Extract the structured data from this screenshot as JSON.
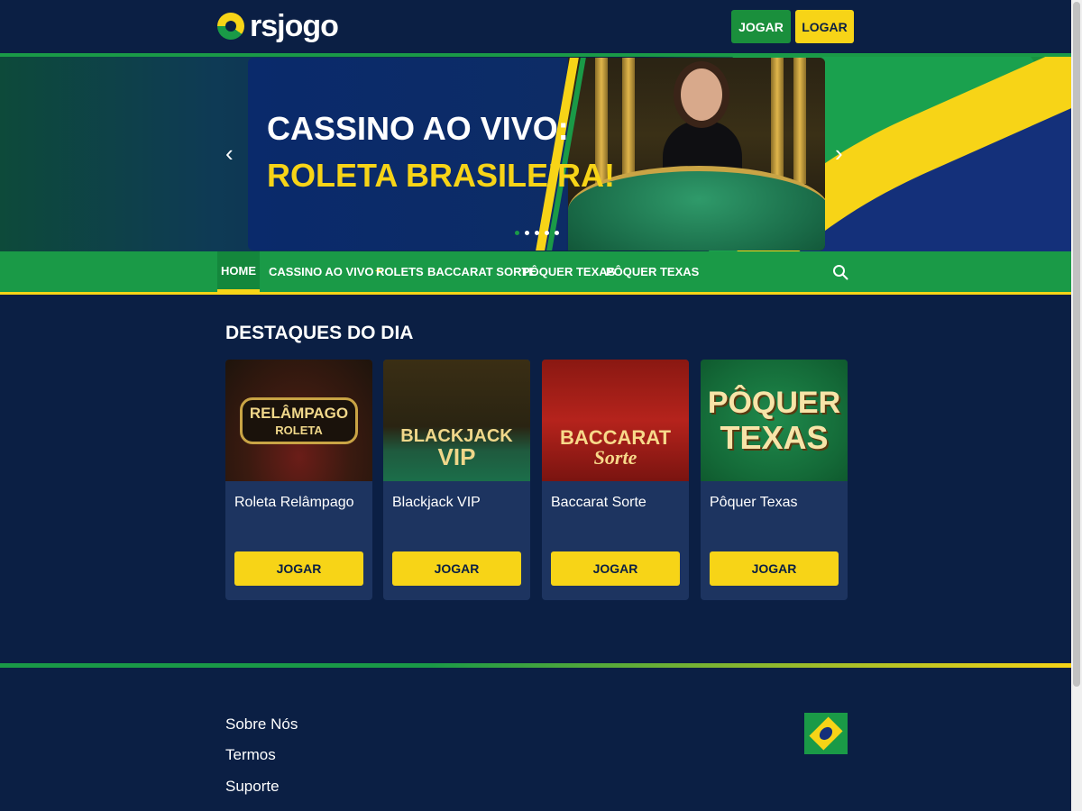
{
  "header": {
    "logo_text": "rsjogo",
    "jogar_label": "JOGAR",
    "logar_label": "LOGAR"
  },
  "hero": {
    "title_line1": "CASSINO AO VIVO:",
    "title_line2": "ROLETA BRASILEIRA!",
    "prev_icon": "‹",
    "next_icon": "›",
    "slide_count": 5,
    "active_slide": 1
  },
  "nav": {
    "items": [
      {
        "label": "HOME"
      },
      {
        "label": "CASSINO AO VIVO"
      },
      {
        "label": "ROLETS"
      },
      {
        "label": "BACCARAT SORTE"
      },
      {
        "label": "PÔQUER TEXAS"
      },
      {
        "label": "PÔQUER TEXAS"
      }
    ],
    "search_icon": "search-icon"
  },
  "featured": {
    "title": "DESTAQUES DO DIA",
    "cards": [
      {
        "name": "Roleta Relâmpago",
        "thumb_line1": "RELÂMPAGO",
        "thumb_line2": "ROLETA",
        "button": "JOGAR"
      },
      {
        "name": "Blackjack VIP",
        "thumb_line1": "BLACKJACK",
        "thumb_line2": "VIP",
        "button": "JOGAR"
      },
      {
        "name": "Baccarat Sorte",
        "thumb_line1": "BACCARAT",
        "thumb_line2": "Sorte",
        "button": "JOGAR"
      },
      {
        "name": "Pôquer Texas",
        "thumb_line1": "PÔQUER",
        "thumb_line2": "TEXAS",
        "button": "JOGAR"
      }
    ]
  },
  "footer": {
    "links": [
      {
        "label": "Sobre Nós"
      },
      {
        "label": "Termos"
      },
      {
        "label": "Suporte"
      }
    ],
    "flag_icon": "brazil-flag-icon"
  },
  "colors": {
    "background": "#0b1f44",
    "green": "#1a9a47",
    "yellow": "#f7d417",
    "card": "#1d3460"
  }
}
